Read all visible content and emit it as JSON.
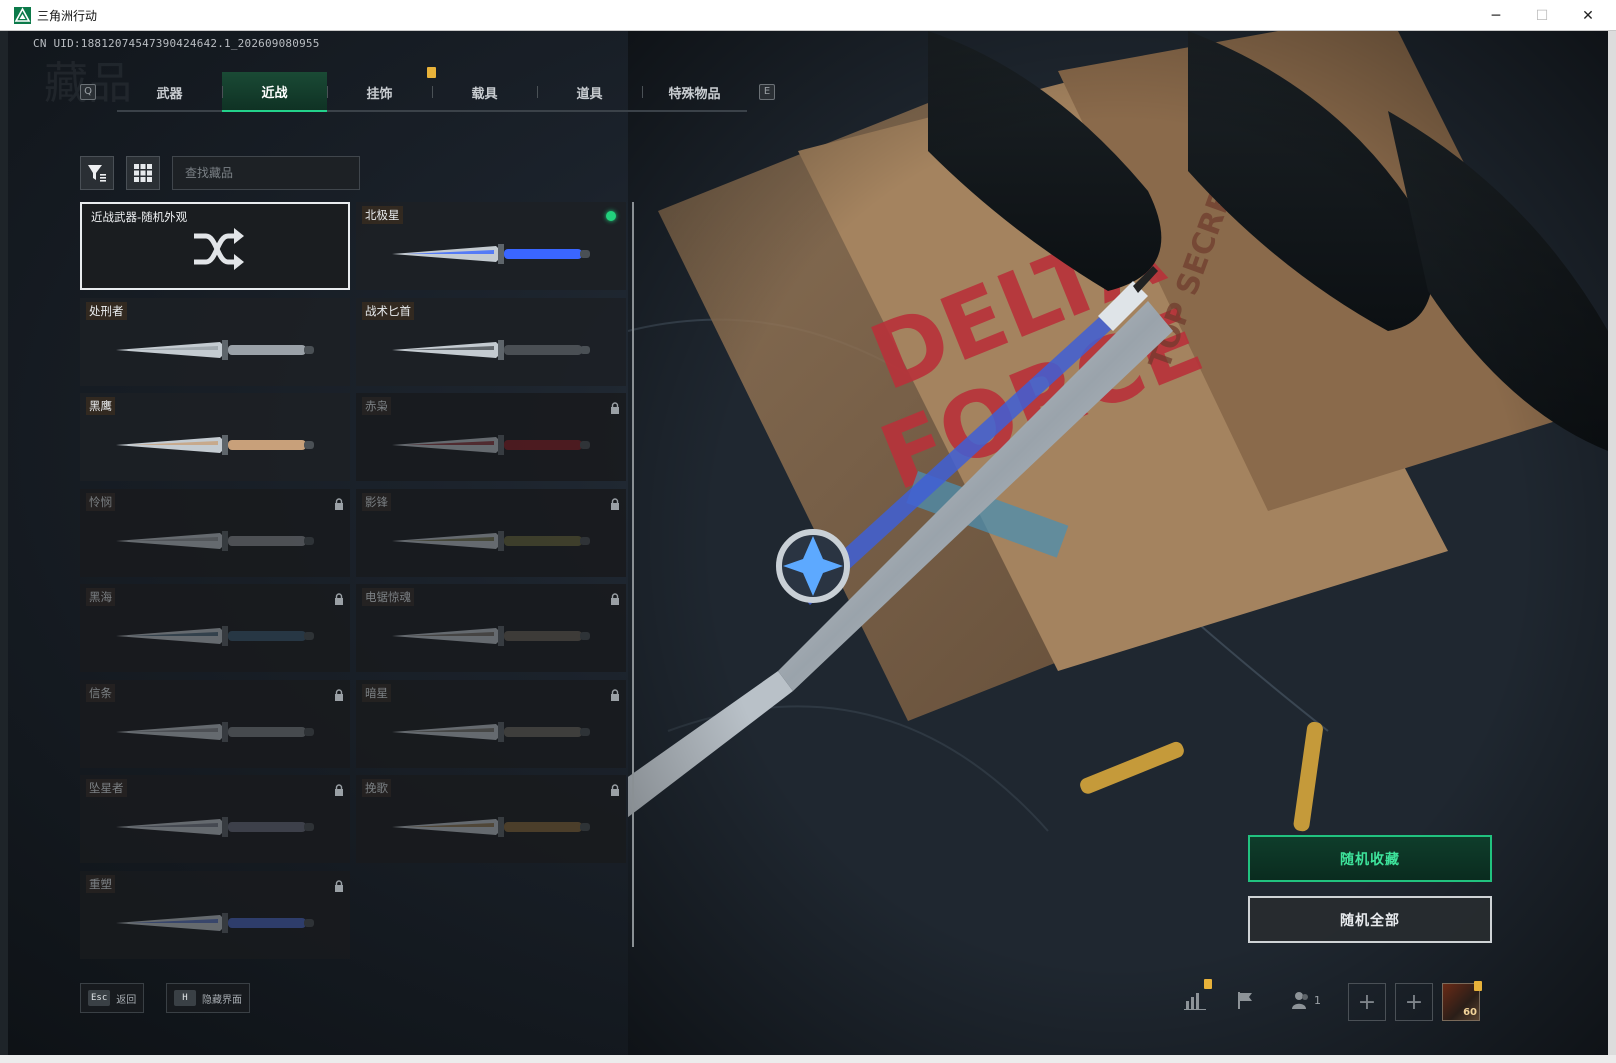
{
  "window": {
    "title": "三角洲行动",
    "controls": {
      "minimize": "─",
      "maximize": "☐",
      "close": "✕"
    }
  },
  "account": {
    "uid": "CN UID:18812074547390424642.1_202609080955"
  },
  "tabs": {
    "prev_key": "Q",
    "next_key": "E",
    "items": [
      {
        "label": "武器",
        "active": false
      },
      {
        "label": "近战",
        "active": true
      },
      {
        "label": "挂饰",
        "active": false
      },
      {
        "label": "载具",
        "active": false
      },
      {
        "label": "道具",
        "active": false
      },
      {
        "label": "特殊物品",
        "active": false
      }
    ]
  },
  "toolbar": {
    "filter_icon": "filter-icon",
    "grid_icon": "grid-view-icon",
    "search_placeholder": "查找藏品"
  },
  "melee_items": [
    {
      "label": "近战武器-随机外观",
      "type": "random",
      "locked": false,
      "equipped": false
    },
    {
      "label": "北极星",
      "locked": false,
      "equipped": true,
      "accent": "#3a66ff"
    },
    {
      "label": "处刑者",
      "locked": false,
      "equipped": false,
      "accent": "#9aa1a8"
    },
    {
      "label": "战术匕首",
      "locked": false,
      "equipped": false,
      "accent": "#4a4f54"
    },
    {
      "label": "黑鹰",
      "locked": false,
      "equipped": false,
      "accent": "#c8a07a"
    },
    {
      "label": "赤枭",
      "locked": true,
      "equipped": false,
      "accent": "#8a1c22"
    },
    {
      "label": "怜悯",
      "locked": true,
      "equipped": false,
      "accent": "#8d9297"
    },
    {
      "label": "影锋",
      "locked": true,
      "equipped": false,
      "accent": "#6b6a3a"
    },
    {
      "label": "黑海",
      "locked": true,
      "equipped": false,
      "accent": "#3a5a72"
    },
    {
      "label": "电锯惊魂",
      "locked": true,
      "equipped": false,
      "accent": "#6a6258"
    },
    {
      "label": "信条",
      "locked": true,
      "equipped": false,
      "accent": "#7f858a"
    },
    {
      "label": "暗星",
      "locked": true,
      "equipped": false,
      "accent": "#6e6a60"
    },
    {
      "label": "坠星者",
      "locked": true,
      "equipped": false,
      "accent": "#6a6f80"
    },
    {
      "label": "挽歌",
      "locked": true,
      "equipped": false,
      "accent": "#8a6a3a"
    },
    {
      "label": "重塑",
      "locked": true,
      "equipped": false,
      "accent": "#4a68c8"
    }
  ],
  "actions": {
    "random_favorite": "随机收藏",
    "random_all": "随机全部"
  },
  "footer": {
    "back_key": "Esc",
    "back_label": "返回",
    "hide_key": "H",
    "hide_label": "隐藏界面",
    "friends_count": "1",
    "avatar_level": "60"
  },
  "colors": {
    "accent_green": "#23d18b",
    "alert_yellow": "#e8b23a",
    "equipped_dot": "#22d17d"
  }
}
